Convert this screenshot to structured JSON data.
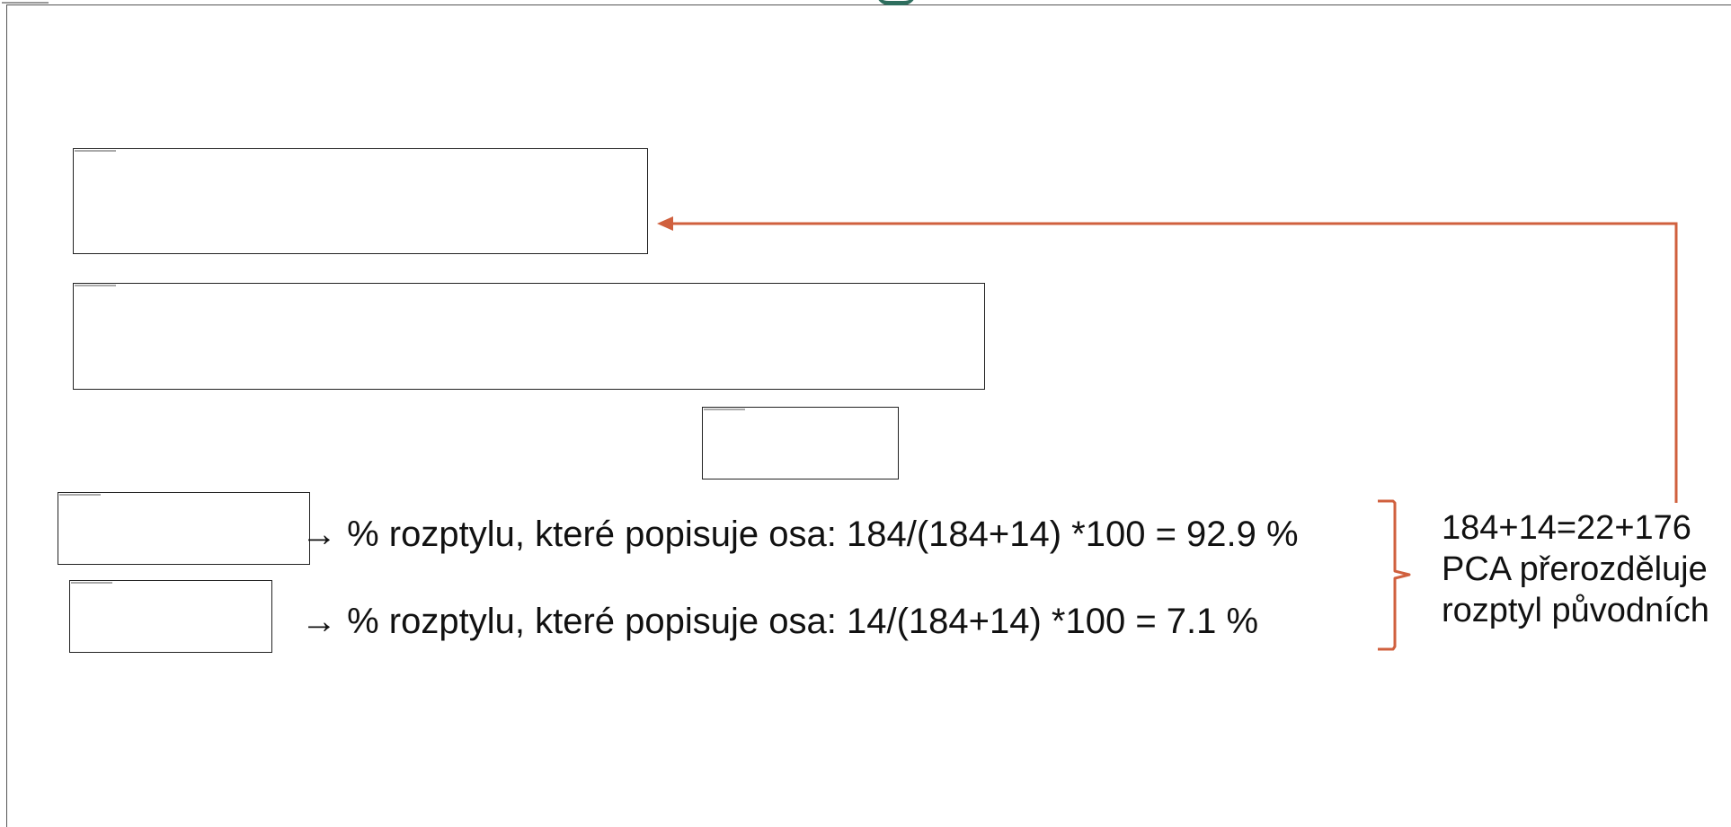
{
  "lines": [
    {
      "arrow": "→",
      "text": "% rozptylu, které popisuje osa: 184/(184+14) *100 = 92.9 %"
    },
    {
      "arrow": "→",
      "text": "% rozptylu, které popisuje osa: 14/(184+14) *100 = 7.1 %"
    }
  ],
  "note": {
    "line_1": "184+14=22+176",
    "line_2": "PCA přerozděluje",
    "line_3": "rozptyl původních"
  },
  "colors": {
    "accent": "#d0603e",
    "text": "#111111",
    "border": "#222222",
    "logo_arc": "#2e6e5e"
  }
}
